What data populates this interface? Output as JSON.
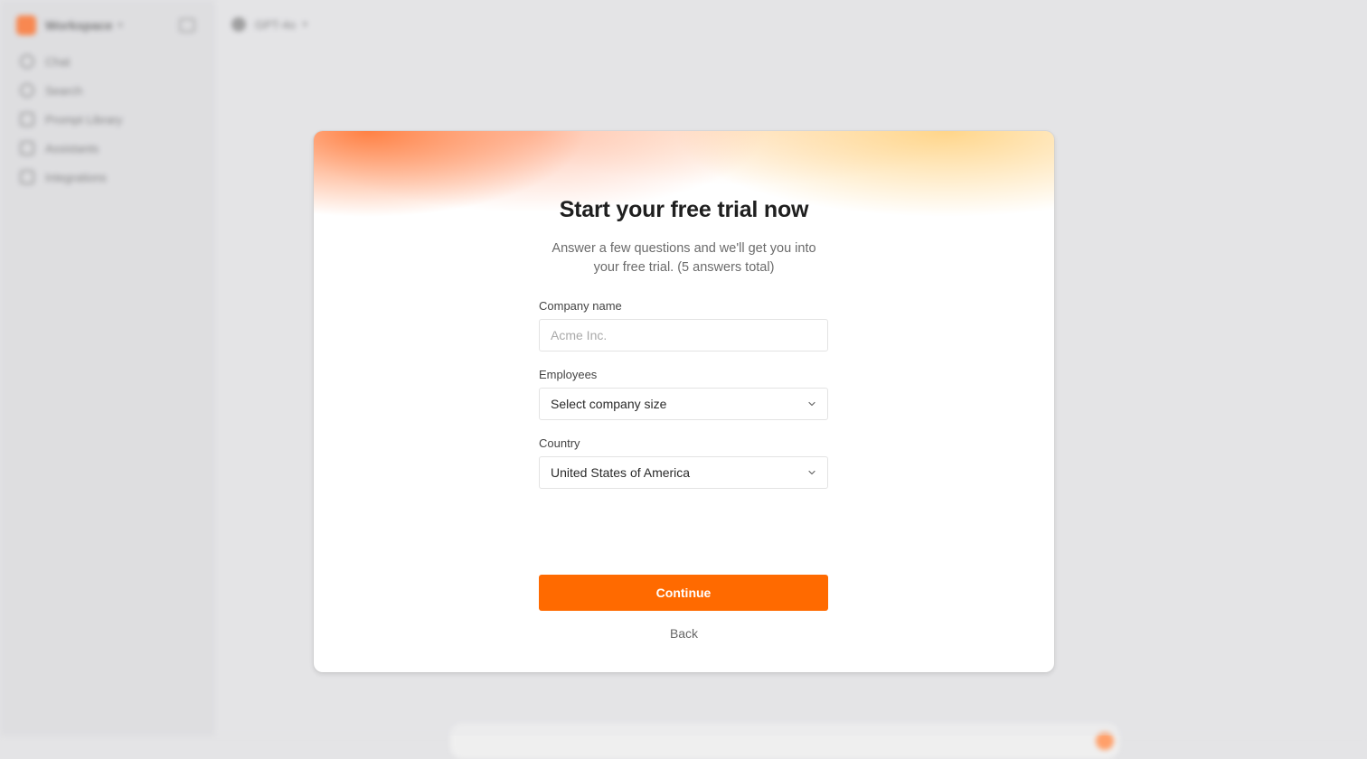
{
  "background": {
    "sidebar": {
      "workspace_name": "Workspace",
      "items": [
        {
          "label": "Chat",
          "icon": "chat-icon"
        },
        {
          "label": "Search",
          "icon": "search-icon"
        },
        {
          "label": "Prompt Library",
          "icon": "library-icon"
        },
        {
          "label": "Assistants",
          "icon": "assistant-icon"
        },
        {
          "label": "Integrations",
          "icon": "integrations-icon"
        }
      ]
    },
    "header": {
      "model_label": "GPT-4o"
    }
  },
  "modal": {
    "title": "Start your free trial now",
    "subtitle_line1": "Answer a few questions and we'll get you into",
    "subtitle_line2": "your free trial. (5 answers total)",
    "company": {
      "label": "Company name",
      "value": "",
      "placeholder": "Acme Inc."
    },
    "employees": {
      "label": "Employees",
      "selected": "Select company size"
    },
    "country": {
      "label": "Country",
      "selected": "United States of America"
    },
    "continue_label": "Continue",
    "back_label": "Back"
  },
  "colors": {
    "accent": "#ff6a00",
    "glow_orange": "#ff7a3a",
    "glow_yellow": "#ffcf70"
  }
}
